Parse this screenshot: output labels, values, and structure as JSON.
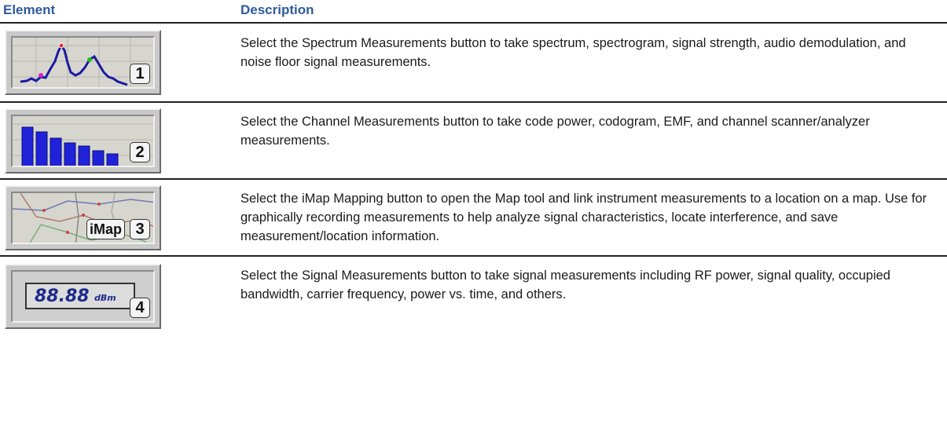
{
  "header": {
    "element_label": "Element",
    "description_label": "Description"
  },
  "rows": [
    {
      "badge": "1",
      "icon": "spectrum-trace-icon",
      "description": "Select the Spectrum Measurements button to take spectrum, spectrogram, signal strength, audio demodulation, and noise floor signal measurements."
    },
    {
      "badge": "2",
      "icon": "channel-bars-icon",
      "description": "Select the Channel Measurements button to take code power, codogram, EMF, and channel scanner/analyzer measurements."
    },
    {
      "badge": "3",
      "badge_label": "iMap",
      "icon": "map-icon",
      "description": "Select the iMap Mapping button to open the Map tool and link instrument measurements to a location on a map.  Use for graphically recording measurements to help analyze signal characteristics, locate interference, and save measurement/location information."
    },
    {
      "badge": "4",
      "icon": "signal-readout-icon",
      "readout_value": "88.88",
      "readout_unit": "dBm",
      "description": "Select the Signal Measurements button to take signal measurements including RF power, signal quality, occupied bandwidth, carrier frequency, power vs. time, and others."
    }
  ],
  "colors": {
    "header_text": "#2f5b9c",
    "bar_fill": "#1f22d8",
    "trace": "#1a1aa0"
  }
}
